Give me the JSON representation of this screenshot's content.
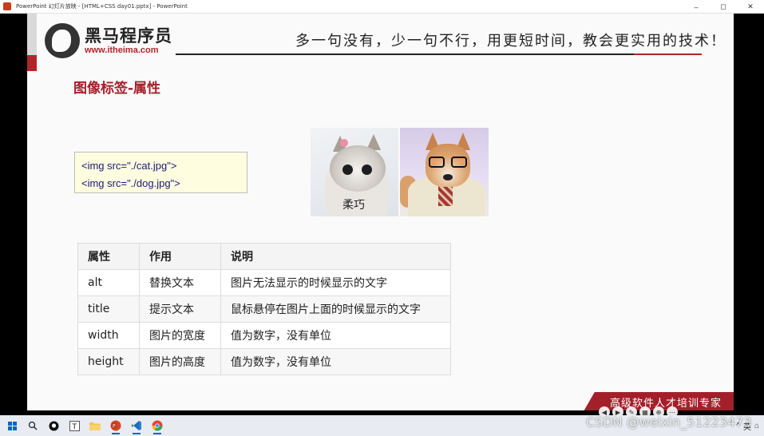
{
  "window": {
    "title": "PowerPoint 幻灯片放映 - [HTML+CSS day01.pptx] - PowerPoint",
    "minimize": "–",
    "maximize": "◻",
    "close": "✕"
  },
  "slide": {
    "logo_cn": "黑马程序员",
    "logo_url": "www.itheima.com",
    "slogan": "多一句没有，少一句不行，用更短时间，教会更实用的技术！",
    "heading": "图像标签-属性",
    "code_lines": [
      "<img  src=\"./cat.jpg\">",
      "<img  src=\"./dog.jpg\">"
    ],
    "cat_caption": "柔巧",
    "banner": "高级软件人才培训专家",
    "table": {
      "headers": [
        "属性",
        "作用",
        "说明"
      ],
      "rows": [
        [
          "alt",
          "替换文本",
          "图片无法显示的时候显示的文字"
        ],
        [
          "title",
          "提示文本",
          "鼠标悬停在图片上面的时候显示的文字"
        ],
        [
          "width",
          "图片的宽度",
          "值为数字，没有单位"
        ],
        [
          "height",
          "图片的高度",
          "值为数字，没有单位"
        ]
      ]
    }
  },
  "slideshow_controls": [
    "◀",
    "▶",
    "✎",
    "▦",
    "⊕",
    "⋯"
  ],
  "taskbar": {
    "icons": [
      "start-icon",
      "search-icon",
      "github-icon",
      "typora-icon",
      "file-explorer-icon",
      "powerpoint-icon",
      "vscode-icon",
      "chrome-icon"
    ],
    "tray": [
      "^",
      "英",
      "⌂"
    ]
  },
  "watermark": "CSDN @weixin_51223473",
  "colors": {
    "brand_red": "#a3202a",
    "code_bg": "#fffde0"
  }
}
